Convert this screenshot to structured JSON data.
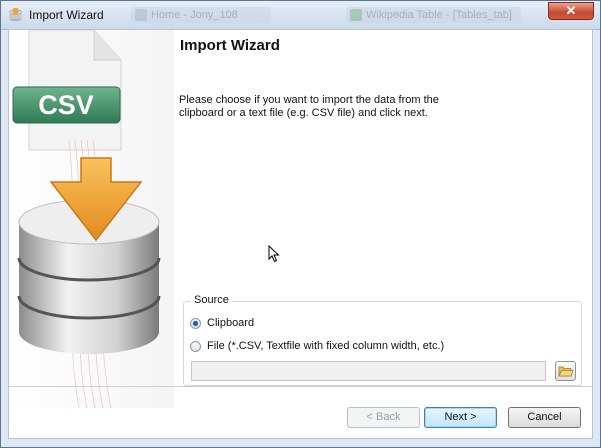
{
  "window": {
    "title": "Import Wizard",
    "close_label": "✕",
    "background_taskbar": [
      {
        "label": "Home - Jony_108"
      },
      {
        "label": "Wikipedia Table - [Tables_tab]"
      }
    ]
  },
  "art": {
    "badge_text": "CSV",
    "image_name": "csv-to-database-import-art"
  },
  "page": {
    "title": "Import Wizard",
    "instructions": "Please choose if you want to import the data from the\nclipboard or a text file (e.g. CSV file) and click next."
  },
  "source": {
    "legend": "Source",
    "options": [
      {
        "label": "Clipboard",
        "checked": true
      },
      {
        "label": "File (*.CSV, Textfile with fixed column width, etc.)",
        "checked": false
      }
    ],
    "file_path_value": ""
  },
  "buttons": {
    "back": "< Back",
    "next": "Next >",
    "cancel": "Cancel"
  },
  "colors": {
    "accent": "#3c7fb1",
    "csv_green": "#3f8a66",
    "arrow_orange": "#e79324",
    "close_red": "#c44a33"
  }
}
